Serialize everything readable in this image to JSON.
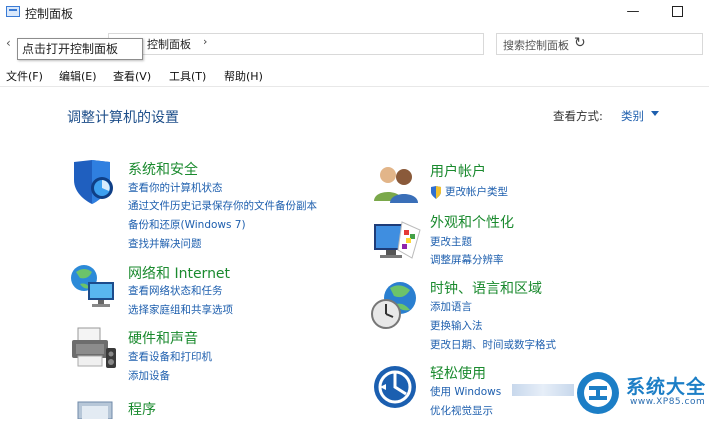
{
  "window": {
    "title": "控制面板",
    "minimize_label": "—"
  },
  "address": {
    "path": "控制面板",
    "chevron": "›",
    "dropdown": "⌄",
    "refresh": "↻",
    "back": "‹"
  },
  "search": {
    "placeholder": "搜索控制面板"
  },
  "tooltip": "点击打开控制面板",
  "menu": [
    "文件(F)",
    "编辑(E)",
    "查看(V)",
    "工具(T)",
    "帮助(H)"
  ],
  "page_heading": "调整计算机的设置",
  "view_by": {
    "label": "查看方式:",
    "value": "类别"
  },
  "left_categories": [
    {
      "title": "系统和安全",
      "icon": "shield-icon",
      "links": [
        "查看你的计算机状态",
        "通过文件历史记录保存你的文件备份副本",
        "备份和还原(Windows 7)",
        "查找并解决问题"
      ]
    },
    {
      "title": "网络和 Internet",
      "icon": "network-icon",
      "links": [
        "查看网络状态和任务",
        "选择家庭组和共享选项"
      ]
    },
    {
      "title": "硬件和声音",
      "icon": "printer-icon",
      "links": [
        "查看设备和打印机",
        "添加设备"
      ]
    },
    {
      "title": "程序",
      "icon": "programs-icon",
      "links": []
    }
  ],
  "right_categories": [
    {
      "title": "用户帐户",
      "icon": "users-icon",
      "links": [
        "更改帐户类型"
      ]
    },
    {
      "title": "外观和个性化",
      "icon": "appearance-icon",
      "links": [
        "更改主题",
        "调整屏幕分辨率"
      ]
    },
    {
      "title": "时钟、语言和区域",
      "icon": "clock-globe-icon",
      "links": [
        "添加语言",
        "更换输入法",
        "更改日期、时间或数字格式"
      ]
    },
    {
      "title": "轻松使用",
      "icon": "ease-of-access-icon",
      "links": [
        "使用 Windows",
        "优化视觉显示"
      ]
    }
  ],
  "watermark": {
    "name": "系统大全",
    "site": "www.XP85.com"
  },
  "colors": {
    "category_title": "#1a8a2e",
    "link": "#1e5fae",
    "heading": "#1e4f8a"
  }
}
